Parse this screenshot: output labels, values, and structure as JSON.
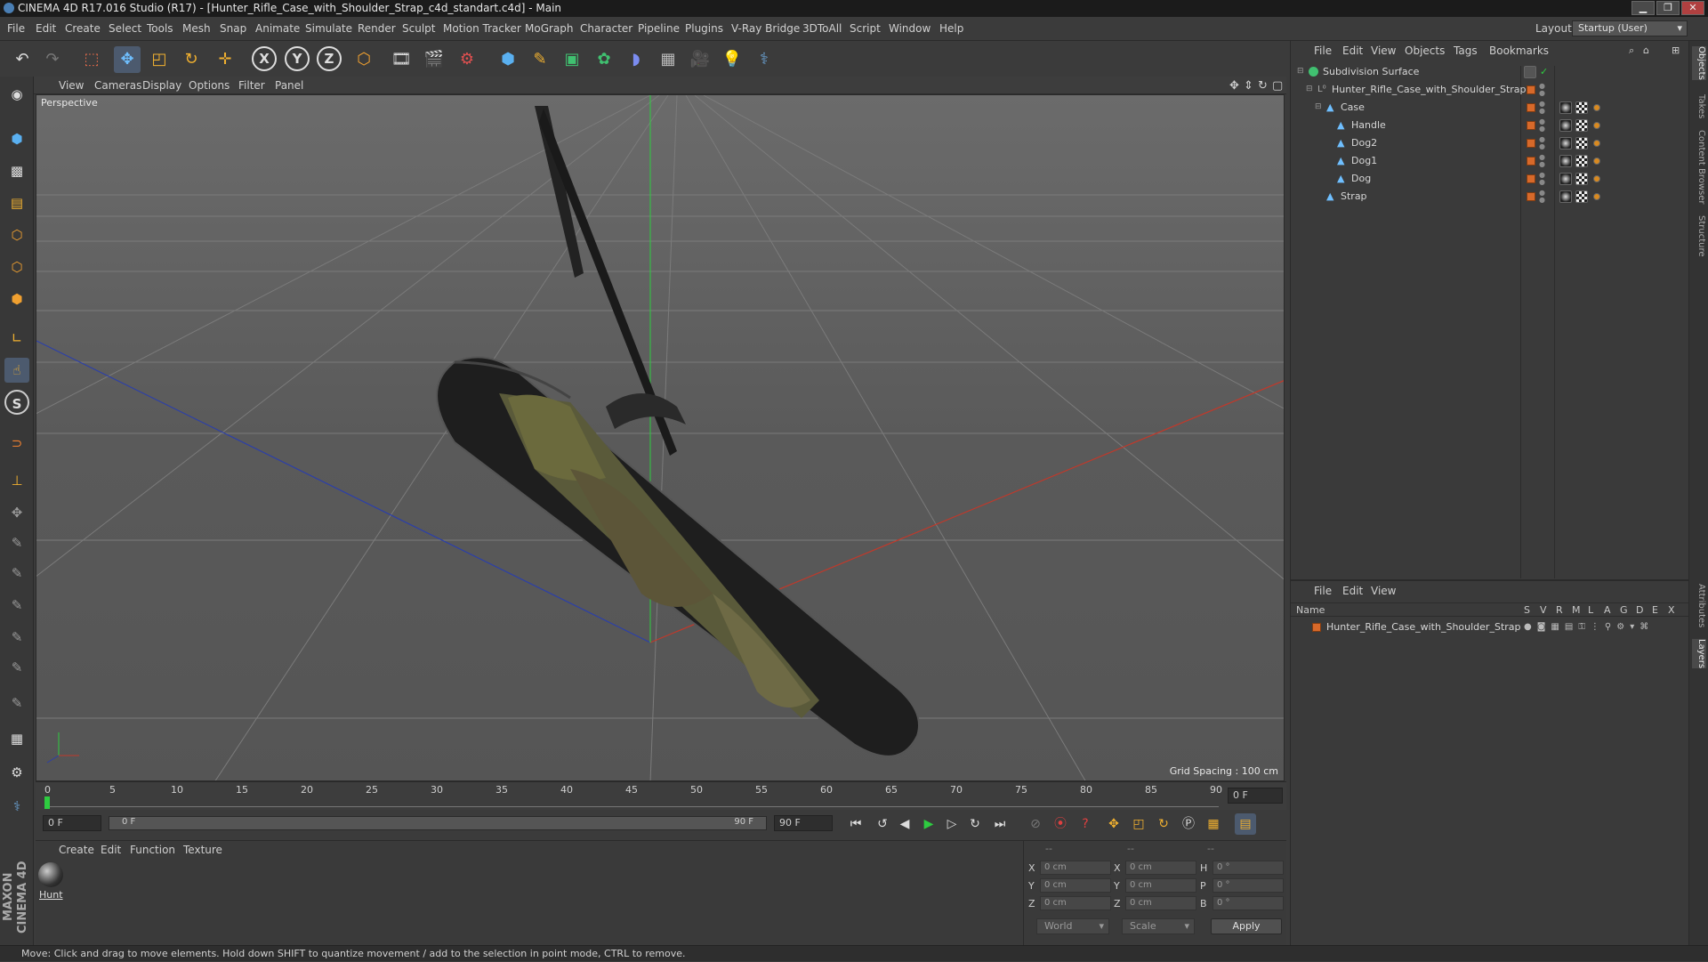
{
  "window": {
    "title": "CINEMA 4D R17.016 Studio (R17) - [Hunter_Rifle_Case_with_Shoulder_Strap_c4d_standart.c4d] - Main",
    "min": "▁",
    "max": "❐",
    "close": "✕"
  },
  "menu": [
    "File",
    "Edit",
    "Create",
    "Select",
    "Tools",
    "Mesh",
    "Snap",
    "Animate",
    "Simulate",
    "Render",
    "Sculpt",
    "Motion Tracker",
    "MoGraph",
    "Character",
    "Pipeline",
    "Plugins",
    "V-Ray Bridge",
    "3DToAll",
    "Script",
    "Window",
    "Help"
  ],
  "layout": {
    "label": "Layout:",
    "value": "Startup (User)"
  },
  "viewport": {
    "menu": [
      "View",
      "Cameras",
      "Display",
      "Options",
      "Filter",
      "Panel"
    ],
    "label": "Perspective",
    "grid_spacing": "Grid Spacing : 100 cm"
  },
  "timeline": {
    "ticks": [
      "0",
      "5",
      "10",
      "15",
      "20",
      "25",
      "30",
      "35",
      "40",
      "45",
      "50",
      "55",
      "60",
      "65",
      "70",
      "75",
      "80",
      "85",
      "90"
    ],
    "current_frame": "0 F",
    "start_field": "0 F",
    "range_start": "0 F",
    "range_end": "90 F",
    "end_field": "90 F"
  },
  "material": {
    "menu": [
      "Create",
      "Edit",
      "Function",
      "Texture"
    ],
    "item": "Hunt"
  },
  "coords": {
    "header": [
      "--",
      "--",
      "--"
    ],
    "rows": [
      {
        "a": "X",
        "v1": "0 cm",
        "b": "X",
        "v2": "0 cm",
        "c": "H",
        "v3": "0 °"
      },
      {
        "a": "Y",
        "v1": "0 cm",
        "b": "Y",
        "v2": "0 cm",
        "c": "P",
        "v3": "0 °"
      },
      {
        "a": "Z",
        "v1": "0 cm",
        "b": "Z",
        "v2": "0 cm",
        "c": "B",
        "v3": "0 °"
      }
    ],
    "world": "World",
    "scale": "Scale",
    "apply": "Apply"
  },
  "objects": {
    "menu": [
      "File",
      "Edit",
      "View",
      "Objects",
      "Tags",
      "Bookmarks"
    ],
    "items": [
      {
        "name": "Subdivision Surface",
        "depth": 0
      },
      {
        "name": "Hunter_Rifle_Case_with_Shoulder_Strap",
        "depth": 1
      },
      {
        "name": "Case",
        "depth": 2
      },
      {
        "name": "Handle",
        "depth": 3
      },
      {
        "name": "Dog2",
        "depth": 3
      },
      {
        "name": "Dog1",
        "depth": 3
      },
      {
        "name": "Dog",
        "depth": 3
      },
      {
        "name": "Strap",
        "depth": 2
      }
    ]
  },
  "layers": {
    "menu": [
      "File",
      "Edit",
      "View"
    ],
    "name_header": "Name",
    "cols": [
      "S",
      "V",
      "R",
      "M",
      "L",
      "A",
      "G",
      "D",
      "E",
      "X"
    ],
    "item": "Hunter_Rifle_Case_with_Shoulder_Strap"
  },
  "right_tabs": [
    "Objects",
    "Takes",
    "Content Browser",
    "Structure",
    "Attributes",
    "Layers"
  ],
  "maxon": "MAXON CINEMA 4D",
  "status": "Move: Click and drag to move elements. Hold down SHIFT to quantize movement / add to the selection in point mode, CTRL to remove.",
  "colors": {
    "accent": "#d7692a",
    "axis_x": "#c0392b",
    "axis_y": "#2ecc40",
    "axis_z": "#2c3fa8"
  }
}
